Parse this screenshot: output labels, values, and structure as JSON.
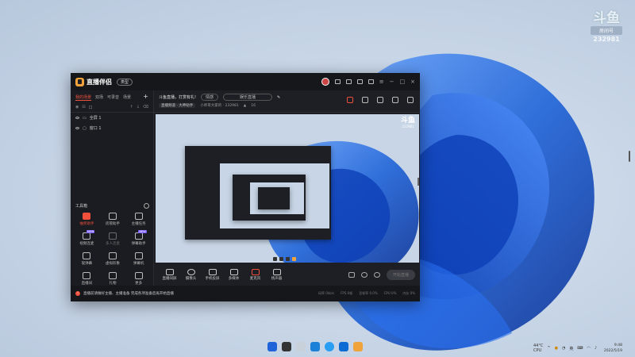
{
  "watermark": {
    "logo": "斗鱼",
    "tag": "房间号",
    "room": "232981"
  },
  "app": {
    "name": "直播伴侣",
    "badge": "类型",
    "left_tabs": [
      {
        "label": "我的场景",
        "active": true
      },
      {
        "label": "双场"
      },
      {
        "label": "可录音"
      },
      {
        "label": "场景"
      }
    ],
    "left_plus": "+",
    "scene_tools": [
      "口",
      "口",
      "口"
    ],
    "scenes": [
      "全屏 1",
      "窗口 1"
    ],
    "toolbox_title": "工具箱",
    "tools": [
      {
        "label": "抽奖助手",
        "hot": true
      },
      {
        "label": "房管助手"
      },
      {
        "label": "主播任务"
      },
      {
        "label": "视频连麦",
        "new": "NEW"
      },
      {
        "label": "多人连麦",
        "dim": true
      },
      {
        "label": "弹幕助手",
        "new": "NEW"
      },
      {
        "label": "观弹幕"
      },
      {
        "label": "虚拟形象"
      },
      {
        "label": "弹幕机"
      },
      {
        "label": "直播间"
      },
      {
        "label": "礼物"
      },
      {
        "label": "更多"
      }
    ],
    "room_title": "斗鱼直播，打赏有礼!",
    "pill_tag": "情感",
    "pill_status": "娱乐直播",
    "category": "直播频道 · 大神助手",
    "room_meta": "小师哥大家的 · 232981",
    "fans": "16",
    "bottom_tools": [
      "直播间屏",
      "摄像头",
      "手机投屏",
      "多媒体",
      "麦克风",
      "扬声器"
    ],
    "start_button": "开始直播",
    "stats": [
      "码率 0kb/s",
      "FPS 0帧",
      "丢帧率 0.0%",
      "CPU 0%",
      "内存 0%"
    ],
    "status_msg": "直播前请做好主播、主播准备 完成各项准备后再开始直播"
  },
  "taskbar": {
    "tray_weather": "44°C",
    "tray_sub": "CPU",
    "tray_lang": "英",
    "time": "9:48",
    "date": "2022/5/19"
  },
  "colors": {
    "accent": "#f0503c",
    "window": "#1d1f24",
    "bloom": "#1f63d8"
  }
}
